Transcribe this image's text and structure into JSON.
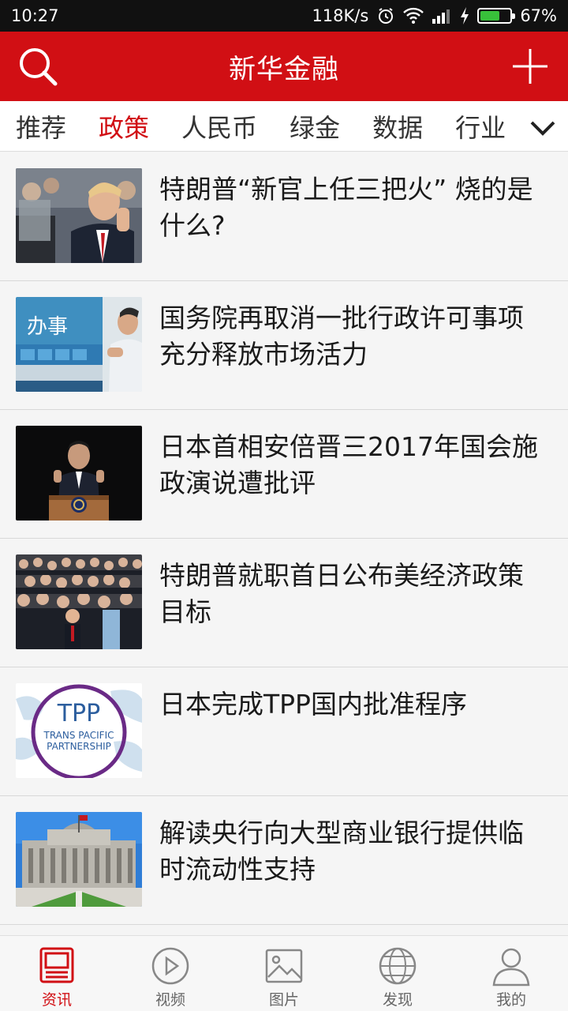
{
  "status": {
    "time": "10:27",
    "speed": "118K/s",
    "battery": "67%",
    "battery_level": 0.67
  },
  "header": {
    "title": "新华金融"
  },
  "tabs": [
    "推荐",
    "政策",
    "人民币",
    "绿金",
    "数据",
    "行业"
  ],
  "active_tab": "政策",
  "news": [
    {
      "title": "特朗普“新官上任三把火” 烧的是什么?"
    },
    {
      "title": "国务院再取消一批行政许可事项 充分释放市场活力"
    },
    {
      "title": "日本首相安倍晋三2017年国会施政演说遭批评"
    },
    {
      "title": "特朗普就职首日公布美经济政策目标"
    },
    {
      "title": "日本完成TPP国内批准程序",
      "thumb_text": [
        "TPP",
        "TRANS PACIFIC",
        "PARTNERSHIP"
      ]
    },
    {
      "title": "解读央行向大型商业银行提供临时流动性支持"
    }
  ],
  "bottom_nav": [
    {
      "label": "资讯",
      "icon": "news-icon"
    },
    {
      "label": "视频",
      "icon": "play-icon"
    },
    {
      "label": "图片",
      "icon": "image-icon"
    },
    {
      "label": "发现",
      "icon": "globe-icon"
    },
    {
      "label": "我的",
      "icon": "user-icon"
    }
  ],
  "colors": {
    "accent": "#d10f14",
    "status_bar": "#111111"
  }
}
